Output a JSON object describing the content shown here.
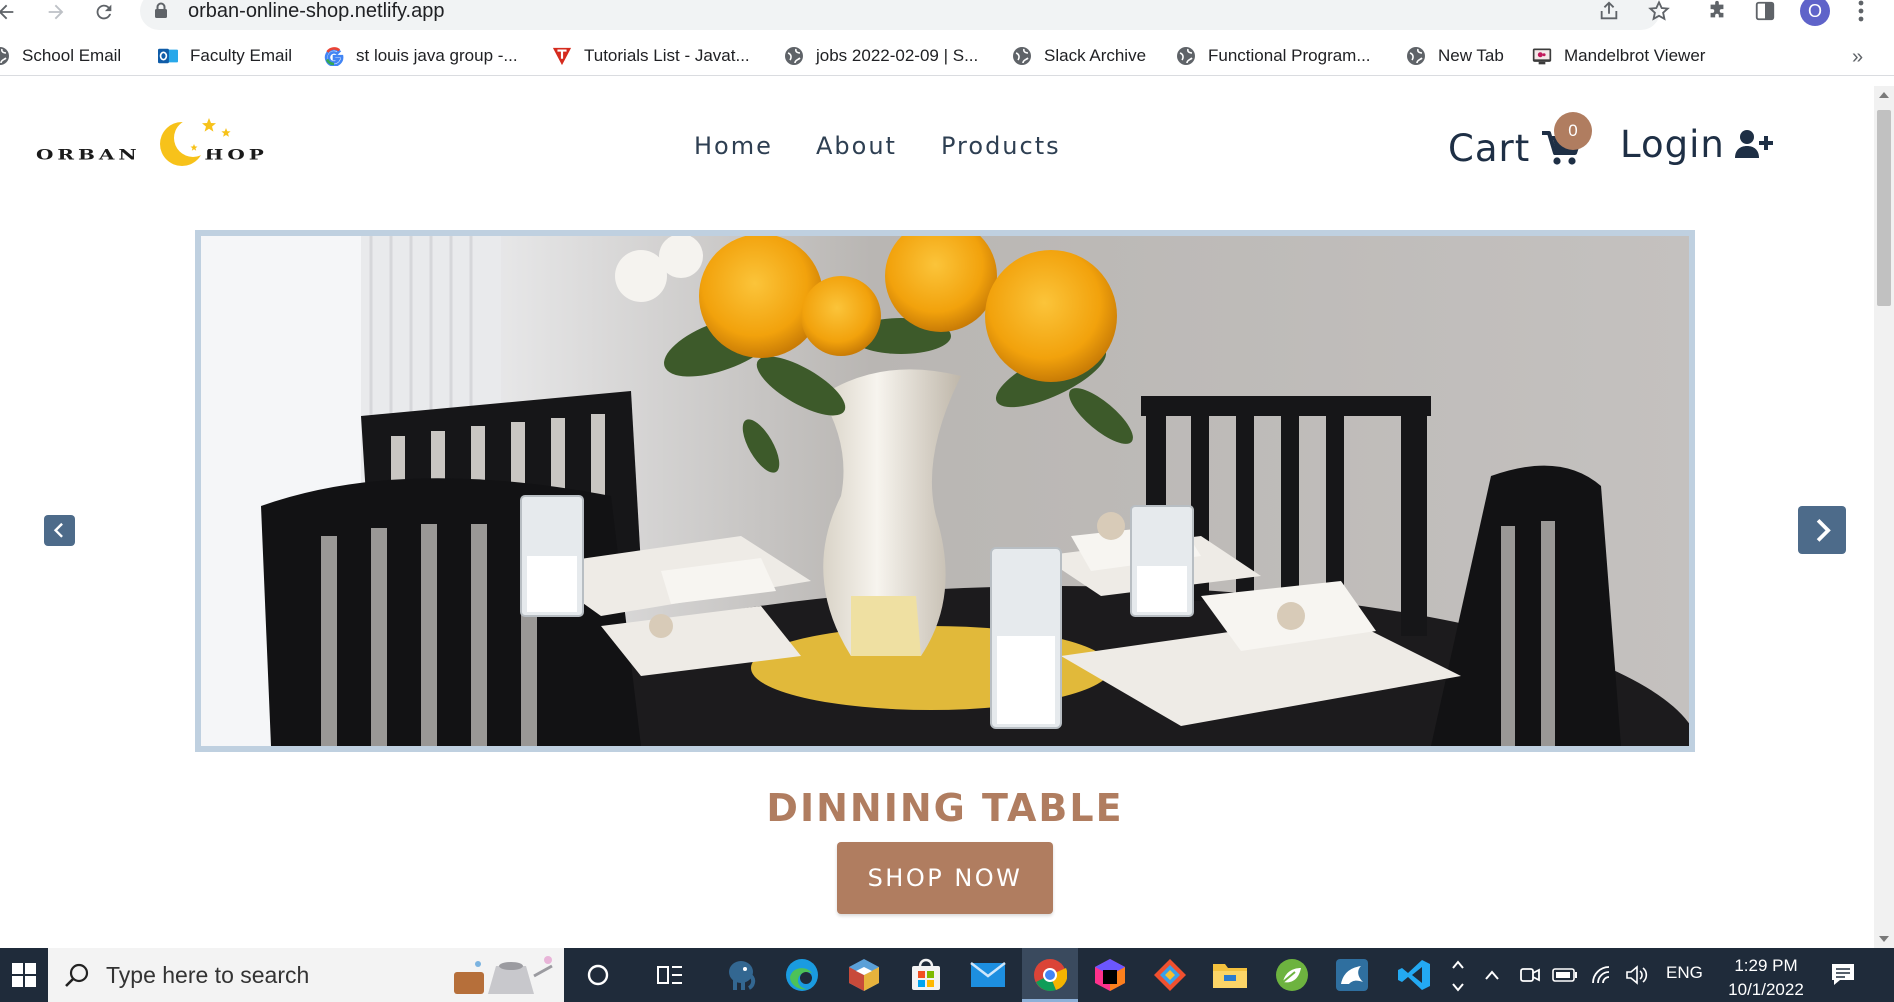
{
  "browser": {
    "url": "orban-online-shop.netlify.app",
    "profile_initial": "O",
    "bookmarks": [
      {
        "label": "School Email",
        "icon": "globe-icon"
      },
      {
        "label": "Faculty Email",
        "icon": "outlook-icon"
      },
      {
        "label": "st louis java group -...",
        "icon": "google-icon"
      },
      {
        "label": "Tutorials List - Javat...",
        "icon": "javatpoint-icon"
      },
      {
        "label": "jobs 2022-02-09 | S...",
        "icon": "globe-icon"
      },
      {
        "label": "Slack Archive",
        "icon": "globe-icon"
      },
      {
        "label": "Functional Program...",
        "icon": "globe-icon"
      },
      {
        "label": "New Tab",
        "icon": "globe-icon"
      },
      {
        "label": "Mandelbrot Viewer",
        "icon": "mandelbrot-icon"
      }
    ],
    "more_label": "»"
  },
  "site": {
    "nav": [
      {
        "label": "Home"
      },
      {
        "label": "About"
      },
      {
        "label": "Products"
      }
    ],
    "cart_label": "Cart",
    "cart_count": "0",
    "login_label": "Login"
  },
  "hero": {
    "title": "DINNING TABLE",
    "button_label": "SHOP NOW",
    "image_subject": "dining table with flowers in a vase"
  },
  "taskbar": {
    "search_placeholder": "Type here to search",
    "language": "ENG",
    "time": "1:29 PM",
    "date": "10/1/2022"
  },
  "colors": {
    "accent": "#b07d60",
    "nav_text": "#2e3f52",
    "carousel_arrow": "#4d6b8a",
    "hero_border": "#bfd0e0",
    "taskbar": "#1f2b3a"
  }
}
